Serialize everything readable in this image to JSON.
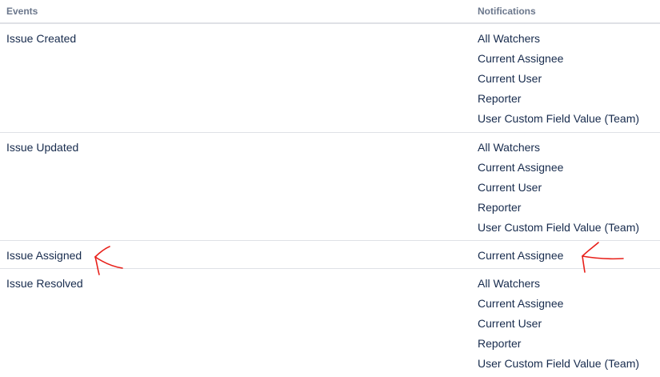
{
  "table": {
    "headers": {
      "events": "Events",
      "notifications": "Notifications"
    },
    "rows": [
      {
        "event": "Issue Created",
        "notifications": [
          "All Watchers",
          "Current Assignee",
          "Current User",
          "Reporter",
          "User Custom Field Value (Team)"
        ]
      },
      {
        "event": "Issue Updated",
        "notifications": [
          "All Watchers",
          "Current Assignee",
          "Current User",
          "Reporter",
          "User Custom Field Value (Team)"
        ]
      },
      {
        "event": "Issue Assigned",
        "notifications": [
          "Current Assignee"
        ]
      },
      {
        "event": "Issue Resolved",
        "notifications": [
          "All Watchers",
          "Current Assignee",
          "Current User",
          "Reporter",
          "User Custom Field Value (Team)"
        ]
      }
    ]
  },
  "annotations": {
    "color": "#e8201a",
    "marks": [
      "red-arrow-left-of-issue-assigned",
      "red-arrow-left-of-current-assignee"
    ]
  }
}
